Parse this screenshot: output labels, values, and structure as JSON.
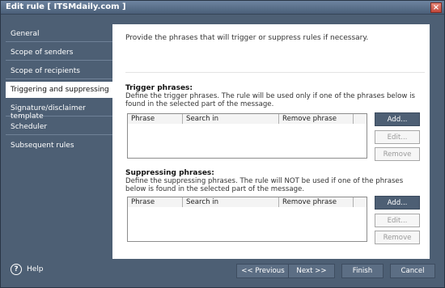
{
  "window": {
    "title": "Edit rule [ ITSMdaily.com ]"
  },
  "sidebar": {
    "items": [
      {
        "label": "General"
      },
      {
        "label": "Scope of senders"
      },
      {
        "label": "Scope of recipients"
      },
      {
        "label": "Triggering and suppressing",
        "active": true
      },
      {
        "label": "Signature/disclaimer template"
      },
      {
        "label": "Scheduler"
      },
      {
        "label": "Subsequent rules"
      }
    ],
    "help_label": "Help"
  },
  "content": {
    "intro": "Provide the phrases that will trigger or suppress rules if necessary.",
    "trigger": {
      "title": "Trigger phrases:",
      "description": "Define the trigger phrases. The rule will be used only if one of the phrases below is found in the selected part of the message.",
      "columns": [
        "Phrase",
        "Search in",
        "Remove phrase"
      ],
      "buttons": {
        "add": "Add...",
        "edit": "Edit...",
        "remove": "Remove"
      }
    },
    "suppress": {
      "title": "Suppressing phrases:",
      "description": "Define the suppressing phrases. The rule will NOT be used if one of the phrases below is found in the selected part of the message.",
      "columns": [
        "Phrase",
        "Search in",
        "Remove phrase"
      ],
      "buttons": {
        "add": "Add...",
        "edit": "Edit...",
        "remove": "Remove"
      }
    }
  },
  "footer": {
    "previous": "<< Previous",
    "next": "Next >>",
    "finish": "Finish",
    "cancel": "Cancel"
  },
  "colors": {
    "frame": "#4d5f74",
    "primary_button": "#4d5f74",
    "content_bg": "#ffffff"
  }
}
